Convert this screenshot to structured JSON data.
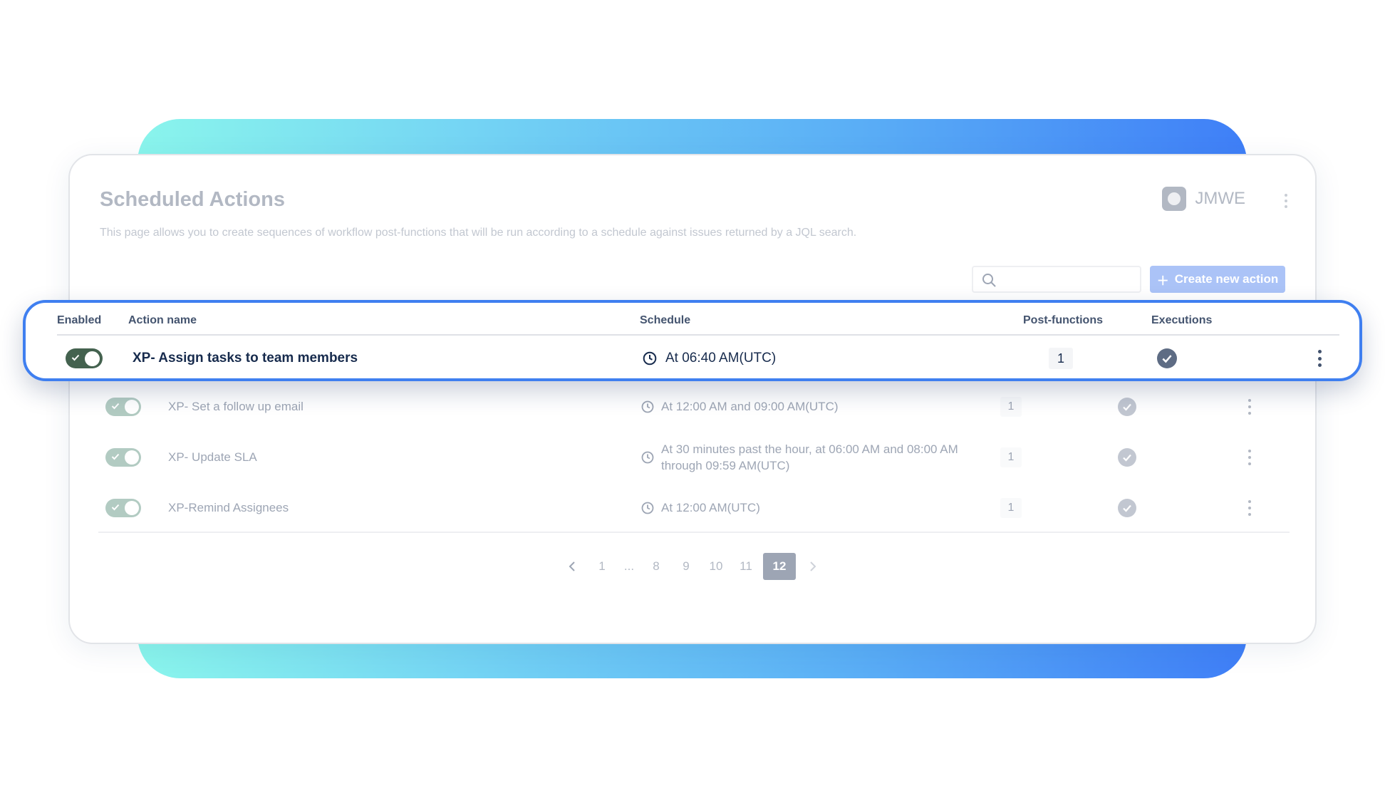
{
  "header": {
    "title": "Scheduled Actions",
    "description": "This page allows you to create sequences of workflow post-functions that will be run according to a schedule against issues returned by a JQL search.",
    "brand": "JMWE"
  },
  "toolbar": {
    "search_placeholder": "",
    "create_label": "Create new action"
  },
  "table": {
    "columns": {
      "enabled": "Enabled",
      "name": "Action name",
      "schedule": "Schedule",
      "post_functions": "Post-functions",
      "executions": "Executions"
    },
    "rows": [
      {
        "enabled": true,
        "name": "XP- Assign tasks to team members",
        "schedule": "At 06:40 AM(UTC)",
        "post_functions": "1",
        "executions": "success"
      },
      {
        "enabled": true,
        "name": "XP- Set a follow up email",
        "schedule": "At 12:00 AM and 09:00 AM(UTC)",
        "post_functions": "1",
        "executions": "success"
      },
      {
        "enabled": true,
        "name": "XP- Update SLA",
        "schedule": "At 30 minutes past the hour, at 06:00 AM and 08:00 AM through 09:59 AM(UTC)",
        "post_functions": "1",
        "executions": "success"
      },
      {
        "enabled": true,
        "name": "XP-Remind Assignees",
        "schedule": "At 12:00 AM(UTC)",
        "post_functions": "1",
        "executions": "success"
      }
    ]
  },
  "pagination": {
    "pages": [
      "1",
      "...",
      "8",
      "9",
      "10",
      "11",
      "12"
    ],
    "current": "12"
  },
  "colors": {
    "accent": "#3f7ff0",
    "toggle_on": "#44624f",
    "button": "#5e8cf0"
  }
}
